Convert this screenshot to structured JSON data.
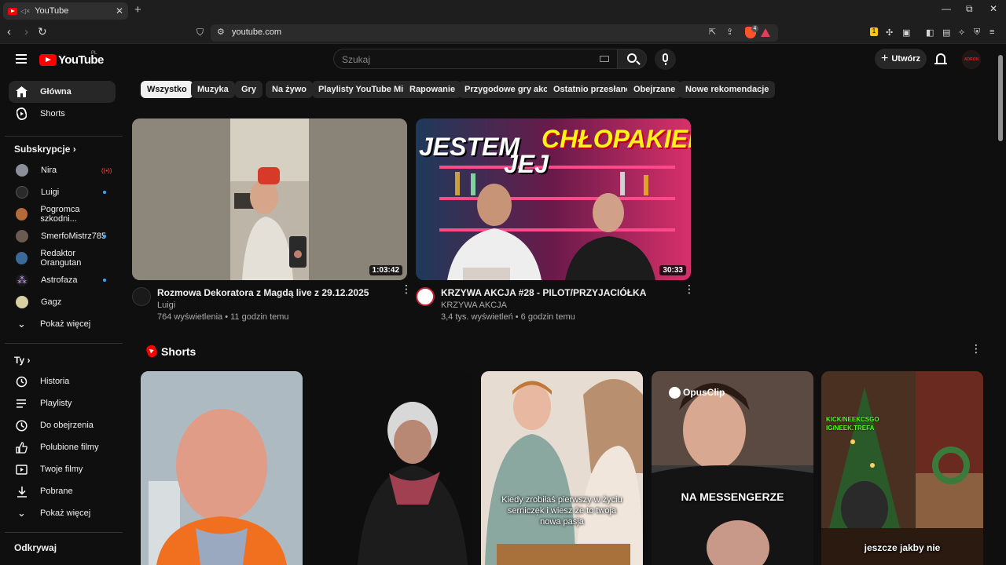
{
  "browser": {
    "tab_title": "YouTube",
    "tab_audio_icon": "audio-off-icon",
    "url": "youtube.com",
    "brave_badge": "4"
  },
  "header": {
    "logo_text": "YouTube",
    "logo_country": "PL",
    "search_placeholder": "Szukaj",
    "create_label": "Utwórz",
    "avatar_text": "ADRON"
  },
  "sidebar": {
    "main": [
      {
        "label": "Główna",
        "icon": "home-icon"
      },
      {
        "label": "Shorts",
        "icon": "shorts-icon"
      }
    ],
    "subscriptions_header": "Subskrypcje",
    "subscriptions": [
      {
        "label": "Nira",
        "status": "live",
        "color": "#8a8f9a"
      },
      {
        "label": "Luigi",
        "status": "new",
        "color": "#2a2a2a"
      },
      {
        "label": "Pogromca szkodni...",
        "status": "",
        "color": "#b56a3a"
      },
      {
        "label": "SmerfoMistrz785",
        "status": "new",
        "color": "#6a5a50"
      },
      {
        "label": "Redaktor Orangutan",
        "status": "",
        "color": "#3a6a9a"
      },
      {
        "label": "Astrofaza",
        "status": "new",
        "color": "#1a1a1a"
      },
      {
        "label": "Gagz",
        "status": "",
        "color": "#d8d0a0"
      }
    ],
    "show_more": "Pokaż więcej",
    "you_header": "Ty",
    "you_items": [
      {
        "label": "Historia",
        "icon": "history-icon"
      },
      {
        "label": "Playlisty",
        "icon": "playlist-icon"
      },
      {
        "label": "Do obejrzenia",
        "icon": "watch-later-icon"
      },
      {
        "label": "Polubione filmy",
        "icon": "like-icon"
      },
      {
        "label": "Twoje filmy",
        "icon": "your-videos-icon"
      },
      {
        "label": "Pobrane",
        "icon": "download-icon"
      }
    ],
    "show_more_2": "Pokaż więcej",
    "explore_header": "Odkrywaj"
  },
  "chips": [
    "Wszystko",
    "Muzyka",
    "Gry",
    "Na żywo",
    "Playlisty YouTube Mix",
    "Rapowanie",
    "Przygodowe gry akcji",
    "Ostatnio przesłane",
    "Obejrzane",
    "Nowe rekomendacje"
  ],
  "videos": [
    {
      "title": "Rozmowa Dekoratora z Magdą live z 29.12.2025",
      "channel": "Luigi",
      "meta": "764 wyświetlenia • 11 godzin temu",
      "duration": "1:03:42"
    },
    {
      "title": "KRZYWA AKCJA #28 - PILOT/PRZYJACIÓŁKA",
      "channel": "KRZYWA AKCJA",
      "meta": "3,4 tys. wyświetleń • 6 godzin temu",
      "duration": "30:33",
      "thumb_text_1": "JESTEM",
      "thumb_text_2": "JEJ",
      "thumb_text_3": "CHŁOPAKIEM!"
    }
  ],
  "shorts": {
    "title": "Shorts",
    "items": [
      {
        "caption": ""
      },
      {
        "caption": ""
      },
      {
        "caption": "Kiedy zrobiłaś pierwszy w życiu sernicze̜k i wiesz że to twoja nowa pasja"
      },
      {
        "caption": "NA MESSENGERZE",
        "brand": "OpusClip"
      },
      {
        "caption": "jeszcze jakby nie",
        "tag1": "KICK/NEEKCSGO",
        "tag2": "IG/NEEK.TREFA"
      }
    ]
  }
}
